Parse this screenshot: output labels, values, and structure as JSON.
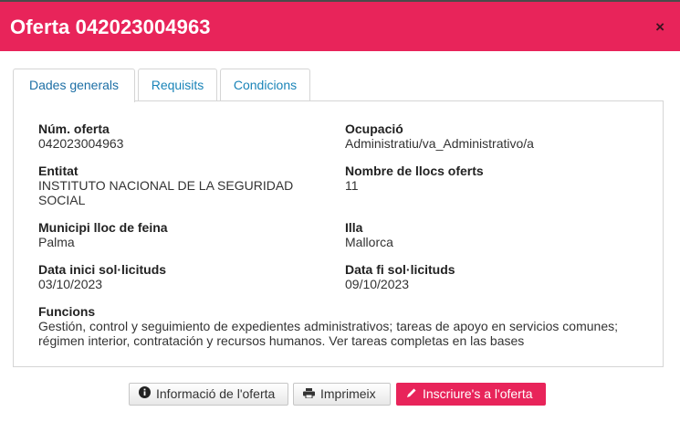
{
  "dialog": {
    "title": "Oferta 042023004963",
    "close_label": "×"
  },
  "tabs": [
    {
      "label": "Dades generals",
      "active": true
    },
    {
      "label": "Requisits",
      "active": false
    },
    {
      "label": "Condicions",
      "active": false
    }
  ],
  "fields": {
    "num_oferta": {
      "label": "Núm. oferta",
      "value": "042023004963"
    },
    "ocupacio": {
      "label": "Ocupació",
      "value": "Administratiu/va_Administrativo/a"
    },
    "entitat": {
      "label": "Entitat",
      "value_line1": "INSTITUTO NACIONAL DE LA SEGURIDAD",
      "value_line2": "SOCIAL"
    },
    "nombre_llocs": {
      "label": "Nombre de llocs oferts",
      "value": "11"
    },
    "municipi": {
      "label": "Municipi lloc de feina",
      "value": "Palma"
    },
    "illa": {
      "label": "Illa",
      "value": "Mallorca"
    },
    "data_inici": {
      "label": "Data inici sol·licituds",
      "value": "03/10/2023"
    },
    "data_fi": {
      "label": "Data fi sol·licituds",
      "value": "09/10/2023"
    },
    "funcions": {
      "label": "Funcions",
      "value_line1": "Gestión, control y seguimiento de expedientes administrativos; tareas de apoyo en servicios comunes;",
      "value_line2": "régimen interior, contratación y recursos humanos. Ver tareas completas en las bases"
    }
  },
  "buttons": {
    "info_label": "Informació de l'oferta",
    "print_label": "Imprimeix",
    "apply_label": "Inscriure's a l'oferta"
  },
  "colors": {
    "brand": "#e8245a",
    "tab_link": "#1a84b8",
    "border": "#d5d5d5"
  }
}
